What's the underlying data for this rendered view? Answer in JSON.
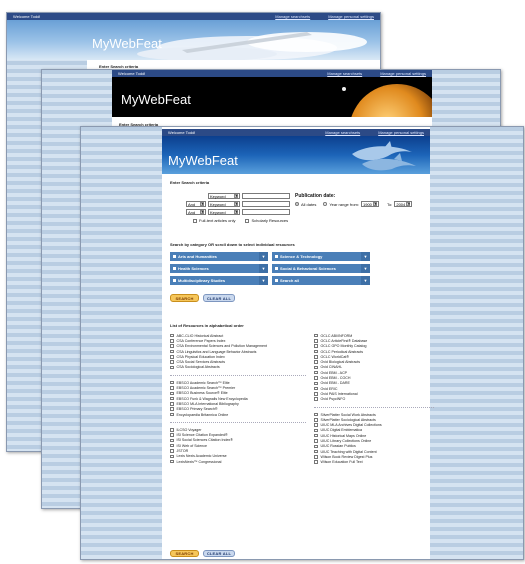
{
  "welcome": "Welcome Todd!",
  "links": {
    "searchsets": "Manage searchsets",
    "settings": "Manage personal settings"
  },
  "brand": "MyWebFeat",
  "criteria_label": "Enter Search criteria",
  "search_rows": [
    {
      "bool": "",
      "field": "Keyword"
    },
    {
      "bool": "And",
      "field": "Keyword"
    },
    {
      "bool": "And",
      "field": "Keyword"
    }
  ],
  "options": {
    "fulltext": "Full-text articles only",
    "scholarly": "Scholarly Resources"
  },
  "pubdate": {
    "label": "Publication date:",
    "all_dates": "All dates",
    "year_range": "Year range from:",
    "from": "1900",
    "to_label": "To:",
    "to": "2004"
  },
  "category_heading": "Search by category OR scroll down to select individual resources",
  "categories": [
    "Arts and Humanities",
    "Science & Technology",
    "Health Sciences",
    "Social & Behavioral Sciences",
    "Multidisciplinary Studies",
    "Search all"
  ],
  "buttons": {
    "search": "SEARCH",
    "clear": "CLEAR ALL"
  },
  "list_heading": "List of Resources in alphabetical order",
  "resources_left": [
    [
      "ABC-CLIO Historical Abstract",
      "CSA Conference Papers Index",
      "CSA Environmental Sciences and Pollution Management",
      "CSA Linguistics and Language Behavior Abstracts",
      "CSA Physical Education Index",
      "CSA Social Services Abstracts",
      "CSA Sociological Abstracts"
    ],
    [
      "EBSCO Academic Search™ Elite",
      "EBSCO Academic Search™ Premier",
      "EBSCO Business Source® Elite",
      "EBSCO Funk & Wagnalls New Encyclopedia",
      "EBSCO MLA International Bibliography",
      "EBSCO Primary Search®",
      "Encyclopaedia Britannica Online"
    ],
    [
      "ILCSO Voyager",
      "ISI Science Citation Expanded®",
      "ISI Social Sciences Citation Index®",
      "ISI Web of Science",
      "JSTOR",
      "Lexis Nexis Academic Universe",
      "LexisNexis™ Congressional"
    ]
  ],
  "resources_right": [
    [
      "OCLC ABI/INFORM",
      "OCLC ArticleFirst® Database",
      "OCLC GPO Monthly Catalog",
      "OCLC Periodical Abstracts",
      "OCLC WorldCat®",
      "Ovid Biological Abstracts",
      "Ovid CINAHL",
      "Ovid EBM - ACP",
      "Ovid EBM - COCH",
      "Ovid EBM - DARE",
      "Ovid ERIC",
      "Ovid PAIS International",
      "Ovid PsycINFO"
    ],
    [
      "SilverPlatter Social Work Abstracts",
      "SilverPlatter Sociological Abstracts",
      "UIUC MLA Archives Digital Collections",
      "UIUC Digital Emblematica",
      "UIUC Historical Maps Online",
      "UIUC Library Collections Online",
      "UIUC Russian Publics",
      "UIUC Teaching with Digital Content",
      "Wilson Book Review Digest Plus",
      "Wilson Education Full Text"
    ]
  ]
}
